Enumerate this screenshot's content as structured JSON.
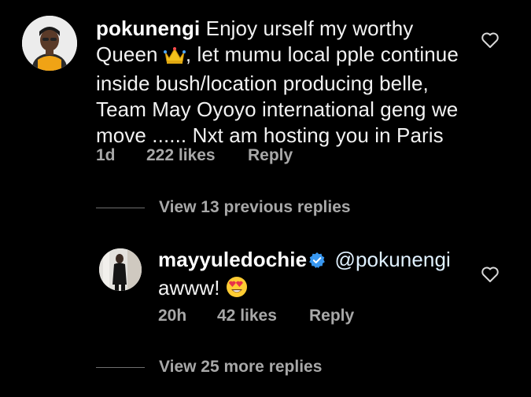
{
  "comments": [
    {
      "username": "pokunengi",
      "text_line1": "Enjoy urself my worthy",
      "text_line2_a": "Queen",
      "crown_emoji": "crown-emoji",
      "text_line2_b": ", let mumu local pple continue",
      "text_line3": "inside bush/location producing belle,",
      "text_line4": "Team May Oyoyo international geng we",
      "text_line5": "move ...... Nxt am hosting you in Paris",
      "time": "1d",
      "likes": "222 likes",
      "reply_label": "Reply"
    }
  ],
  "previous_replies_label": "View 13 previous replies",
  "reply": {
    "username": "mayyuledochie",
    "verified": true,
    "mention": "@pokunengi",
    "text": "awww!",
    "emoji": "heart-eyes-emoji",
    "time": "20h",
    "likes": "42 likes",
    "reply_label": "Reply"
  },
  "more_replies_label": "View 25 more replies",
  "colors": {
    "background": "#000000",
    "text": "#f5f5f5",
    "secondary_text": "#a8a8a8",
    "verified_blue": "#3897f0"
  }
}
